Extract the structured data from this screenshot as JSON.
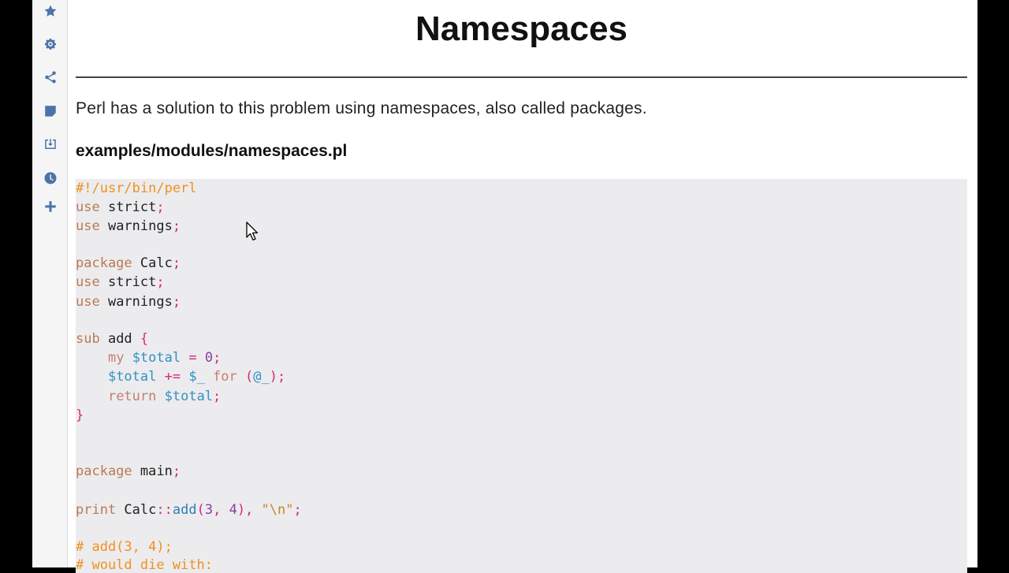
{
  "sidebar": {
    "items": [
      {
        "icon": "star-icon"
      },
      {
        "icon": "gear-icon"
      },
      {
        "icon": "share-icon"
      },
      {
        "icon": "note-icon"
      },
      {
        "icon": "download-icon"
      },
      {
        "icon": "history-icon"
      },
      {
        "icon": "plus-icon"
      }
    ]
  },
  "page": {
    "title": "Namespaces",
    "intro": "Perl has a solution to this problem using namespaces, also called packages.",
    "file_name": "examples/modules/namespaces.pl"
  },
  "code": {
    "lines": [
      [
        {
          "t": "#!/usr/bin/perl",
          "c": "comment"
        }
      ],
      [
        {
          "t": "use",
          "c": "kw"
        },
        {
          "t": " strict",
          "c": "ident"
        },
        {
          "t": ";",
          "c": "semi"
        }
      ],
      [
        {
          "t": "use",
          "c": "kw"
        },
        {
          "t": " warnings",
          "c": "ident"
        },
        {
          "t": ";",
          "c": "semi"
        }
      ],
      [],
      [
        {
          "t": "package",
          "c": "kw"
        },
        {
          "t": " Calc",
          "c": "ident"
        },
        {
          "t": ";",
          "c": "semi"
        }
      ],
      [
        {
          "t": "use",
          "c": "kw"
        },
        {
          "t": " strict",
          "c": "ident"
        },
        {
          "t": ";",
          "c": "semi"
        }
      ],
      [
        {
          "t": "use",
          "c": "kw"
        },
        {
          "t": " warnings",
          "c": "ident"
        },
        {
          "t": ";",
          "c": "semi"
        }
      ],
      [],
      [
        {
          "t": "sub",
          "c": "kw"
        },
        {
          "t": " add ",
          "c": "ident"
        },
        {
          "t": "{",
          "c": "brace"
        }
      ],
      [
        {
          "t": "    ",
          "c": "ident"
        },
        {
          "t": "my",
          "c": "kw2"
        },
        {
          "t": " ",
          "c": "ident"
        },
        {
          "t": "$total",
          "c": "var"
        },
        {
          "t": " = ",
          "c": "op"
        },
        {
          "t": "0",
          "c": "num"
        },
        {
          "t": ";",
          "c": "semi"
        }
      ],
      [
        {
          "t": "    ",
          "c": "ident"
        },
        {
          "t": "$total",
          "c": "var"
        },
        {
          "t": " += ",
          "c": "op"
        },
        {
          "t": "$_",
          "c": "var"
        },
        {
          "t": " for ",
          "c": "kw2"
        },
        {
          "t": "(",
          "c": "op"
        },
        {
          "t": "@_",
          "c": "var"
        },
        {
          "t": ");",
          "c": "semi"
        }
      ],
      [
        {
          "t": "    ",
          "c": "ident"
        },
        {
          "t": "return",
          "c": "kw2"
        },
        {
          "t": " ",
          "c": "ident"
        },
        {
          "t": "$total",
          "c": "var"
        },
        {
          "t": ";",
          "c": "semi"
        }
      ],
      [
        {
          "t": "}",
          "c": "brace"
        }
      ],
      [],
      [],
      [
        {
          "t": "package",
          "c": "kw"
        },
        {
          "t": " main",
          "c": "ident"
        },
        {
          "t": ";",
          "c": "semi"
        }
      ],
      [],
      [
        {
          "t": "print",
          "c": "kw"
        },
        {
          "t": " Calc",
          "c": "ident"
        },
        {
          "t": "::",
          "c": "op"
        },
        {
          "t": "add",
          "c": "fn"
        },
        {
          "t": "(",
          "c": "op"
        },
        {
          "t": "3",
          "c": "num"
        },
        {
          "t": ", ",
          "c": "op"
        },
        {
          "t": "4",
          "c": "num"
        },
        {
          "t": "), ",
          "c": "op"
        },
        {
          "t": "\"\\n\"",
          "c": "str"
        },
        {
          "t": ";",
          "c": "semi"
        }
      ],
      [],
      [
        {
          "t": "# add(3, 4);",
          "c": "comment"
        }
      ],
      [
        {
          "t": "# would die with:",
          "c": "comment"
        }
      ]
    ]
  }
}
